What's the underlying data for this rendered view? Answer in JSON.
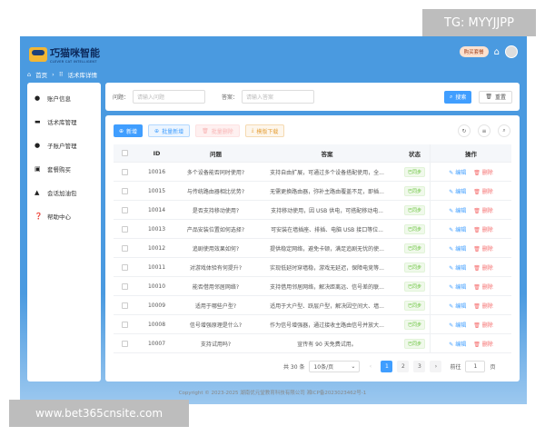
{
  "brand": {
    "name": "巧猫咪智能",
    "tagline": "CLEVER CAT INTELLIGENT"
  },
  "breadcrumb": [
    "首页",
    "话术库详情"
  ],
  "header": {
    "buy_label": "购买套餐"
  },
  "sidebar": {
    "items": [
      {
        "label": "账户信息",
        "icon": "user-icon"
      },
      {
        "label": "话术库管理",
        "icon": "monitor-icon"
      },
      {
        "label": "子账户管理",
        "icon": "user-icon"
      },
      {
        "label": "套餐购买",
        "icon": "cart-icon"
      },
      {
        "label": "会话加油包",
        "icon": "bag-icon"
      },
      {
        "label": "帮助中心",
        "icon": "help-icon"
      }
    ]
  },
  "search": {
    "q_label": "问题：",
    "q_placeholder": "请输入问题",
    "a_label": "答案：",
    "a_placeholder": "请输入答案",
    "search_label": "搜索",
    "reset_label": "重置"
  },
  "toolbar": {
    "add": "新增",
    "batch_add": "批量新增",
    "batch_delete": "批量删除",
    "template_download": "模版下载"
  },
  "table": {
    "columns": [
      "ID",
      "问题",
      "答案",
      "状态",
      "操作"
    ],
    "edit_label": "编辑",
    "delete_label": "删除",
    "rows": [
      {
        "id": "10016",
        "q": "多个设备能否同时使用?",
        "a": "支持自由扩展，可通过多个设备搭配使用，全...",
        "status": "已同步"
      },
      {
        "id": "10015",
        "q": "与传统路由器相比优势?",
        "a": "无需更换路由器，弥补主路由覆盖不足，即插...",
        "status": "已同步"
      },
      {
        "id": "10014",
        "q": "是否支持移动使用?",
        "a": "支持移动使用，因 USB 供电，可搭配移动电...",
        "status": "已同步"
      },
      {
        "id": "10013",
        "q": "产品安装位置如何选择?",
        "a": "可安装在墙插座、排插、电脑 USB 接口等位...",
        "status": "已同步"
      },
      {
        "id": "10012",
        "q": "追剧使用效果如何?",
        "a": "提供稳定网络，避免卡顿，满足追剧无忧的使...",
        "status": "已同步"
      },
      {
        "id": "10011",
        "q": "对游戏体验有何提升?",
        "a": "实现低延时穿墙稳，游戏无延迟，保障电竞等...",
        "status": "已同步"
      },
      {
        "id": "10010",
        "q": "能否借用邻居网络?",
        "a": "支持借用邻居网络，解决距离远、信号差的联...",
        "status": "已同步"
      },
      {
        "id": "10009",
        "q": "适用于哪些户型?",
        "a": "适用于大户型、跃层户型，解决因空间大、墙...",
        "status": "已同步"
      },
      {
        "id": "10008",
        "q": "信号增强原理是什么?",
        "a": "作为信号增强器，通过接收主路由信号并放大...",
        "status": "已同步"
      },
      {
        "id": "10007",
        "q": "支持试用吗?",
        "a": "宣传有 90 天免费试用。",
        "status": "已同步"
      }
    ]
  },
  "pagination": {
    "total": "共 30 条",
    "page_size": "10条/页",
    "pages": [
      "1",
      "2",
      "3"
    ],
    "current": "1",
    "goto_label": "前往",
    "goto_value": "1",
    "page_suffix": "页"
  },
  "footer": "Copyright © 2023-2025 湖南优元堂教育科技有限公司 湘ICP备2023023462号-1",
  "watermarks": [
    "TG: MYYJJPP",
    "www.bet365cnsite.com"
  ],
  "colors": {
    "primary": "#409eff",
    "header": "#4a9ae0",
    "success": "#67c23a",
    "danger": "#f56c6c"
  }
}
